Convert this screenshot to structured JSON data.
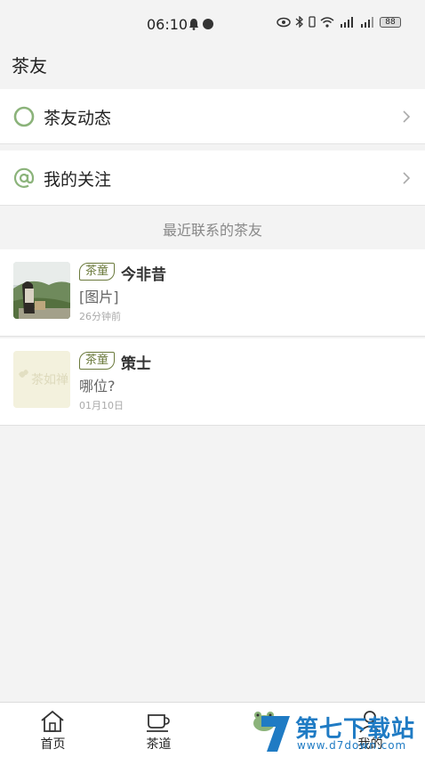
{
  "status_bar": {
    "time": "06:10",
    "battery": "88"
  },
  "header": {
    "title": "茶友"
  },
  "menu": [
    {
      "label": "茶友动态",
      "icon": "circle-icon"
    },
    {
      "label": "我的关注",
      "icon": "at-icon"
    }
  ],
  "section": {
    "title": "最近联系的茶友"
  },
  "contacts": [
    {
      "tag": "茶童",
      "name": "今非昔",
      "message": "[图片]",
      "time": "26分钟前",
      "avatar": "photo-avatar"
    },
    {
      "tag": "茶童",
      "name": "策士",
      "message": "哪位?",
      "time": "01月10日",
      "avatar": "placeholder-logo-avatar"
    }
  ],
  "avatar_placeholder_text": "茶如禅",
  "tabs": [
    {
      "label": "首页",
      "icon": "house-icon"
    },
    {
      "label": "茶道",
      "icon": "teacup-icon"
    },
    {
      "label": "",
      "icon": "frog-icon"
    },
    {
      "label": "我的",
      "icon": "person-icon"
    }
  ],
  "watermark": {
    "brand": "第七下载站",
    "url": "www.d7down.com"
  },
  "colors": {
    "accent_green": "#8bb37a",
    "tag_olive": "#6b7a3c",
    "watermark_blue": "#1f7bc4"
  }
}
